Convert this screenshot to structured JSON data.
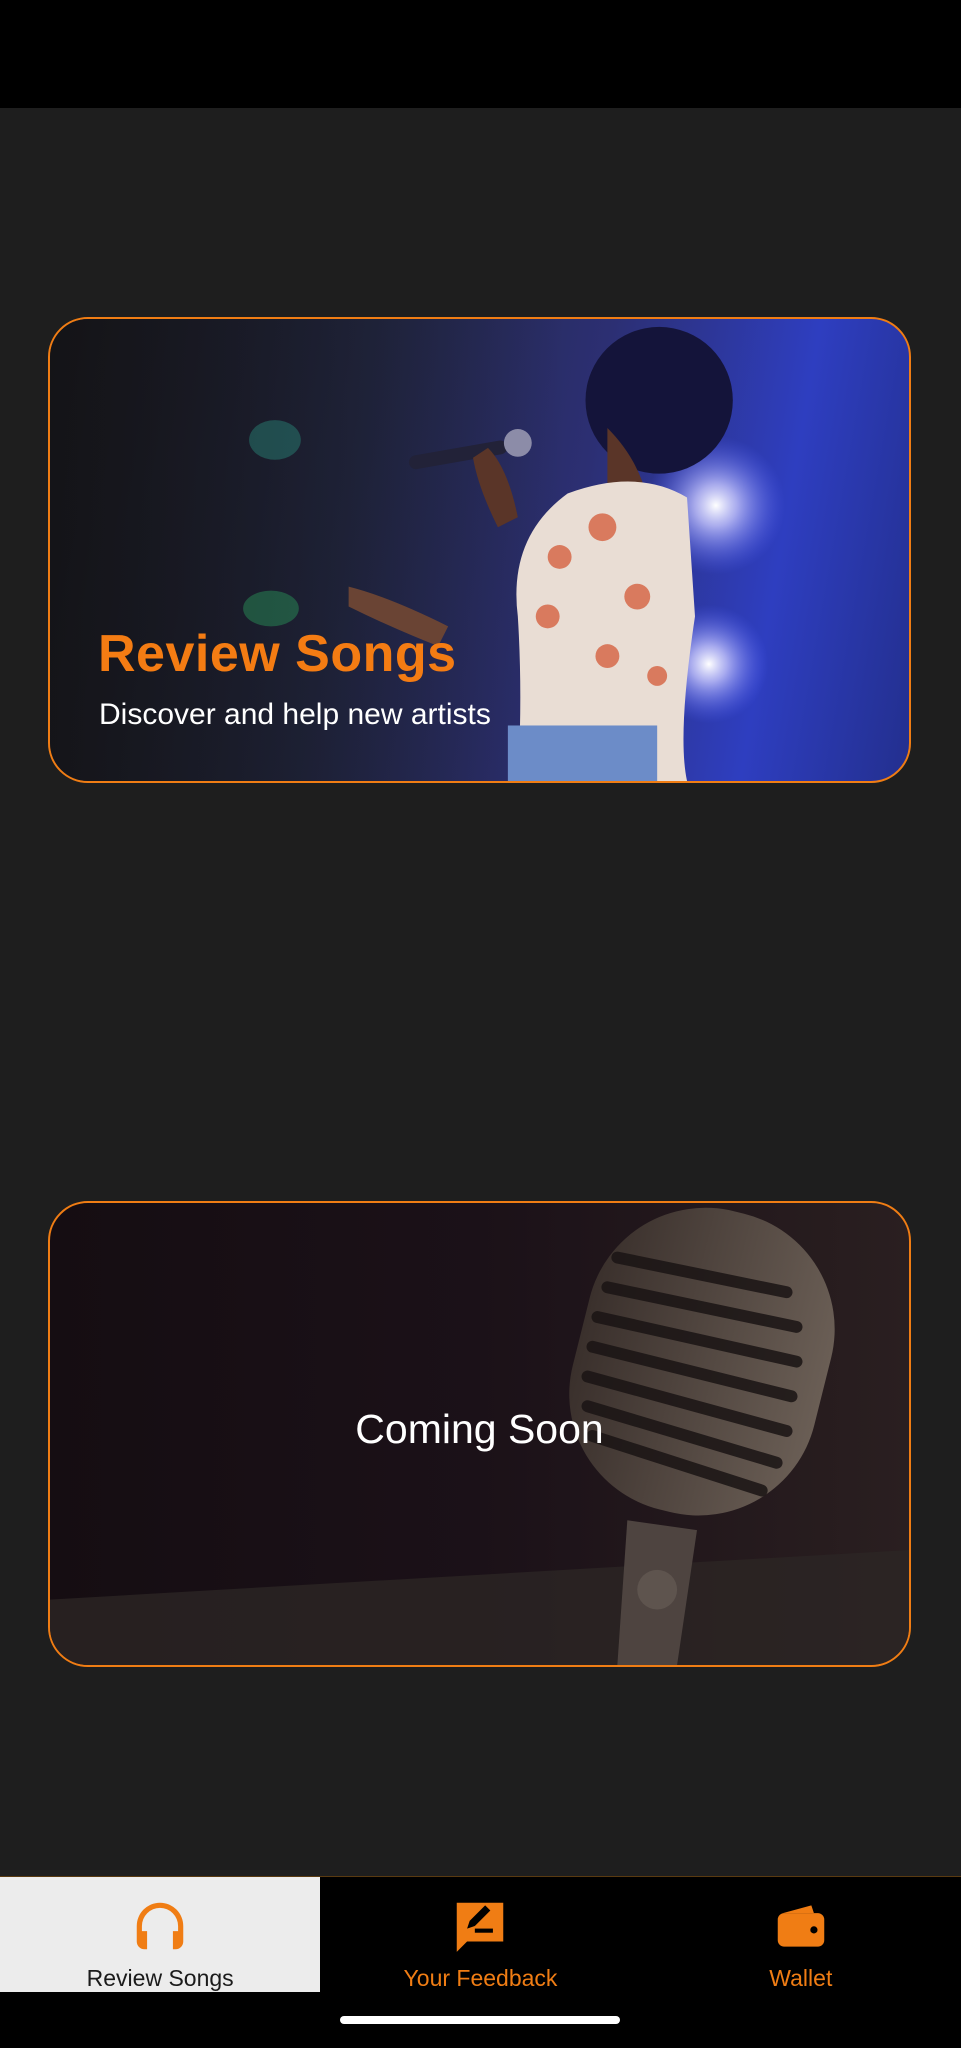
{
  "cards": [
    {
      "title": "Review Songs",
      "subtitle": "Discover and help new artists"
    },
    {
      "title": "Coming Soon"
    }
  ],
  "nav": {
    "items": [
      {
        "label": "Review Songs",
        "icon": "headphones-icon",
        "active": true
      },
      {
        "label": "Your Feedback",
        "icon": "feedback-icon",
        "active": false
      },
      {
        "label": "Wallet",
        "icon": "wallet-icon",
        "active": false
      }
    ]
  },
  "colors": {
    "accent": "#f07d14",
    "background": "#1e1e1e",
    "nav_background": "#000000",
    "nav_active_background": "#ececec"
  }
}
